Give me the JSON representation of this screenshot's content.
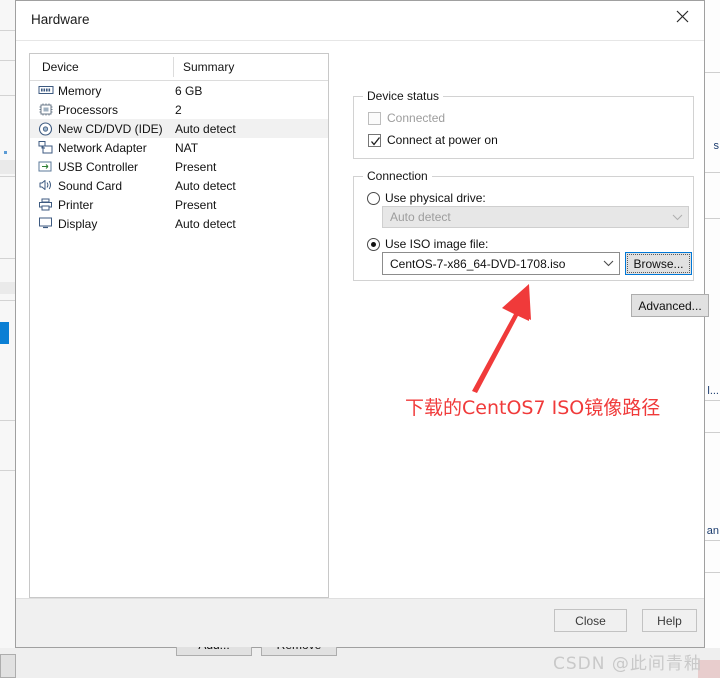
{
  "window": {
    "title": "Hardware",
    "close_icon": "close-icon"
  },
  "device_list": {
    "columns": [
      "Device",
      "Summary"
    ],
    "rows": [
      {
        "icon": "memory-icon",
        "name": "Memory",
        "summary": "6 GB",
        "selected": false
      },
      {
        "icon": "processor-icon",
        "name": "Processors",
        "summary": "2",
        "selected": false
      },
      {
        "icon": "cd-dvd-icon",
        "name": "New CD/DVD (IDE)",
        "summary": "Auto detect",
        "selected": true
      },
      {
        "icon": "network-icon",
        "name": "Network Adapter",
        "summary": "NAT",
        "selected": false
      },
      {
        "icon": "usb-icon",
        "name": "USB Controller",
        "summary": "Present",
        "selected": false
      },
      {
        "icon": "sound-icon",
        "name": "Sound Card",
        "summary": "Auto detect",
        "selected": false
      },
      {
        "icon": "printer-icon",
        "name": "Printer",
        "summary": "Present",
        "selected": false
      },
      {
        "icon": "display-icon",
        "name": "Display",
        "summary": "Auto detect",
        "selected": false
      }
    ],
    "add_label": "Add...",
    "remove_label": "Remove"
  },
  "device_status": {
    "legend": "Device status",
    "connected_label": "Connected",
    "connected_checked": false,
    "connected_enabled": false,
    "power_on_label": "Connect at power on",
    "power_on_checked": true
  },
  "connection": {
    "legend": "Connection",
    "physical_drive_label": "Use physical drive:",
    "physical_drive_selected": false,
    "physical_drive_value": "Auto detect",
    "iso_file_label": "Use ISO image file:",
    "iso_file_selected": true,
    "iso_file_value": "CentOS-7-x86_64-DVD-1708.iso",
    "browse_label": "Browse...",
    "advanced_label": "Advanced..."
  },
  "annotation": {
    "text": "下载的CentOS7 ISO镜像路径",
    "color": "#f03a3a",
    "arrow_icon": "up-arrow-annotation-icon"
  },
  "footer": {
    "close_label": "Close",
    "help_label": "Help"
  },
  "watermark": {
    "text": "CSDN @此间青釉"
  },
  "background": {
    "fragments": [
      "s",
      "l...",
      "an"
    ]
  }
}
